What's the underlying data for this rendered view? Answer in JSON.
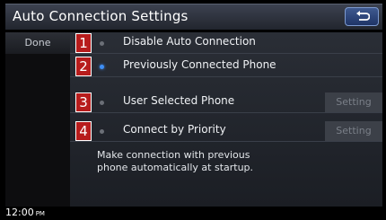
{
  "header": {
    "title": "Auto Connection Settings",
    "back_icon": "back-arrow-icon"
  },
  "sidebar": {
    "done_label": "Done"
  },
  "options": [
    {
      "badge": "1",
      "label": "Disable Auto Connection",
      "selected": false,
      "setting": ""
    },
    {
      "badge": "2",
      "label": "Previously Connected Phone",
      "selected": true,
      "setting": ""
    },
    {
      "badge": "3",
      "label": "User Selected Phone",
      "selected": false,
      "setting": "Setting"
    },
    {
      "badge": "4",
      "label": "Connect by Priority",
      "selected": false,
      "setting": "Setting"
    }
  ],
  "description": {
    "line1": "Make connection with previous",
    "line2": "phone automatically at startup."
  },
  "status": {
    "time": "12:00",
    "ampm": "PM"
  },
  "colors": {
    "accent": "#3e8ef5",
    "badge": "#b71c1c"
  }
}
